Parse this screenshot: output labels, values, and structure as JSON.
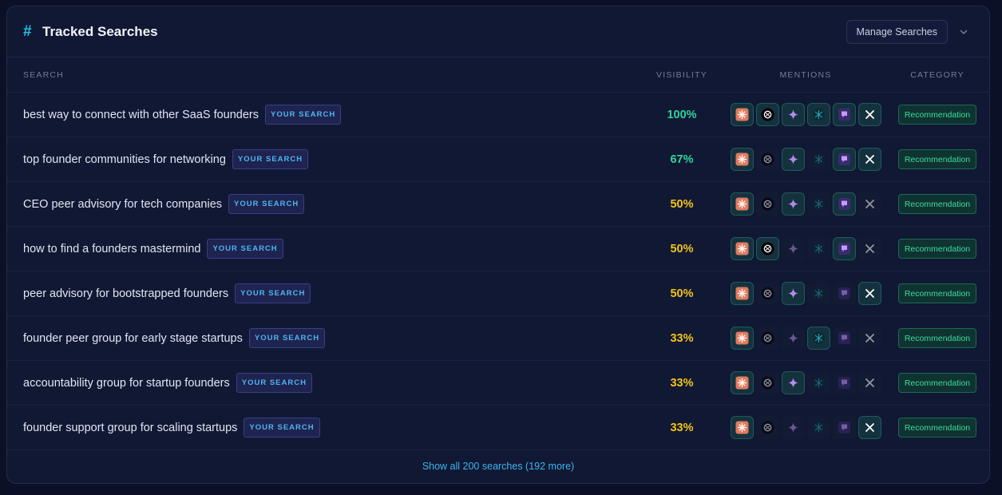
{
  "header": {
    "hash_symbol": "#",
    "title": "Tracked Searches",
    "manage_label": "Manage Searches"
  },
  "columns": {
    "search": "SEARCH",
    "visibility": "VISIBILITY",
    "mentions": "MENTIONS",
    "category": "CATEGORY"
  },
  "mention_icons": [
    "claude-icon",
    "chatgpt-icon",
    "gemini-icon",
    "perplexity-icon",
    "copilot-icon",
    "grok-icon"
  ],
  "colors": {
    "high_visibility": "#2fd59c",
    "mid_visibility": "#f2c417",
    "accent": "#22c3e6",
    "category": "#3ddba0"
  },
  "rows": [
    {
      "query": "best way to connect with other SaaS founders",
      "badge": "YOUR SEARCH",
      "visibility": "100%",
      "visibility_color": "#2fd59c",
      "mentions": [
        true,
        true,
        true,
        true,
        true,
        true
      ],
      "category": "Recommendation"
    },
    {
      "query": "top founder communities for networking",
      "badge": "YOUR SEARCH",
      "visibility": "67%",
      "visibility_color": "#2fd59c",
      "mentions": [
        true,
        false,
        true,
        false,
        true,
        true
      ],
      "category": "Recommendation"
    },
    {
      "query": "CEO peer advisory for tech companies",
      "badge": "YOUR SEARCH",
      "visibility": "50%",
      "visibility_color": "#f2c417",
      "mentions": [
        true,
        false,
        true,
        false,
        true,
        false
      ],
      "category": "Recommendation"
    },
    {
      "query": "how to find a founders mastermind",
      "badge": "YOUR SEARCH",
      "visibility": "50%",
      "visibility_color": "#f2c417",
      "mentions": [
        true,
        true,
        false,
        false,
        true,
        false
      ],
      "category": "Recommendation"
    },
    {
      "query": "peer advisory for bootstrapped founders",
      "badge": "YOUR SEARCH",
      "visibility": "50%",
      "visibility_color": "#f2c417",
      "mentions": [
        true,
        false,
        true,
        false,
        false,
        true
      ],
      "category": "Recommendation"
    },
    {
      "query": "founder peer group for early stage startups",
      "badge": "YOUR SEARCH",
      "visibility": "33%",
      "visibility_color": "#f2c417",
      "mentions": [
        true,
        false,
        false,
        true,
        false,
        false
      ],
      "category": "Recommendation"
    },
    {
      "query": "accountability group for startup founders",
      "badge": "YOUR SEARCH",
      "visibility": "33%",
      "visibility_color": "#f2c417",
      "mentions": [
        true,
        false,
        true,
        false,
        false,
        false
      ],
      "category": "Recommendation"
    },
    {
      "query": "founder support group for scaling startups",
      "badge": "YOUR SEARCH",
      "visibility": "33%",
      "visibility_color": "#f2c417",
      "mentions": [
        true,
        false,
        false,
        false,
        false,
        true
      ],
      "category": "Recommendation"
    }
  ],
  "footer": {
    "show_all": "Show all 200 searches (192 more)"
  }
}
